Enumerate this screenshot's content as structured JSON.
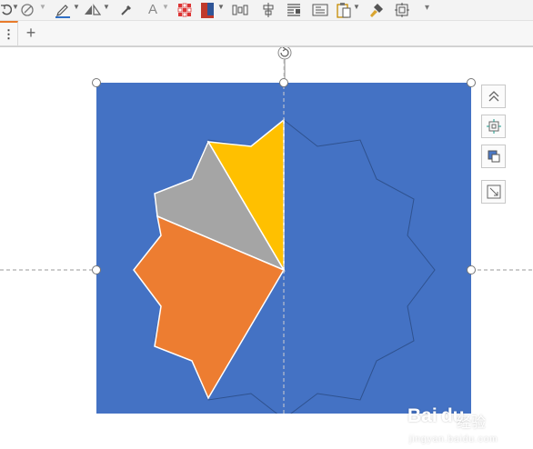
{
  "toolbar": {
    "items": [
      {
        "name": "rotate-dropdown-icon"
      },
      {
        "name": "shape-fill-icon"
      },
      {
        "name": "pen-color-icon"
      },
      {
        "name": "shape-outline-icon"
      },
      {
        "name": "eyedropper-icon"
      },
      {
        "name": "text-style-icon"
      },
      {
        "name": "color-grid-icon"
      },
      {
        "name": "fill-color-icon"
      },
      {
        "name": "distribute-icon"
      },
      {
        "name": "align-icon"
      },
      {
        "name": "text-wrap-icon"
      },
      {
        "name": "text-box-icon"
      },
      {
        "name": "paste-icon"
      },
      {
        "name": "format-painter-icon"
      },
      {
        "name": "select-icon"
      },
      {
        "name": "more-dropdown-icon"
      }
    ],
    "colors": {
      "accent": "#e87a2a",
      "fill_swatch": "#c0392b",
      "pen": "#2f6fc5"
    }
  },
  "tabbar": {
    "more_label": "⋮",
    "add_label": "+"
  },
  "slide": {
    "background": "#4472c4",
    "segments": [
      {
        "name": "yellow-segment",
        "color": "#ffc000"
      },
      {
        "name": "gray-segment",
        "color": "#a5a5a5"
      },
      {
        "name": "orange-segment",
        "color": "#ed7d31"
      }
    ],
    "outline_color": "#2f528f"
  },
  "side_buttons": [
    {
      "name": "bring-forward-button"
    },
    {
      "name": "crop-button"
    },
    {
      "name": "layer-button"
    },
    {
      "name": "resize-button"
    }
  ],
  "watermark": {
    "logo": "Bai du",
    "sub": "经验",
    "url": "jingyan.baidu.com"
  }
}
